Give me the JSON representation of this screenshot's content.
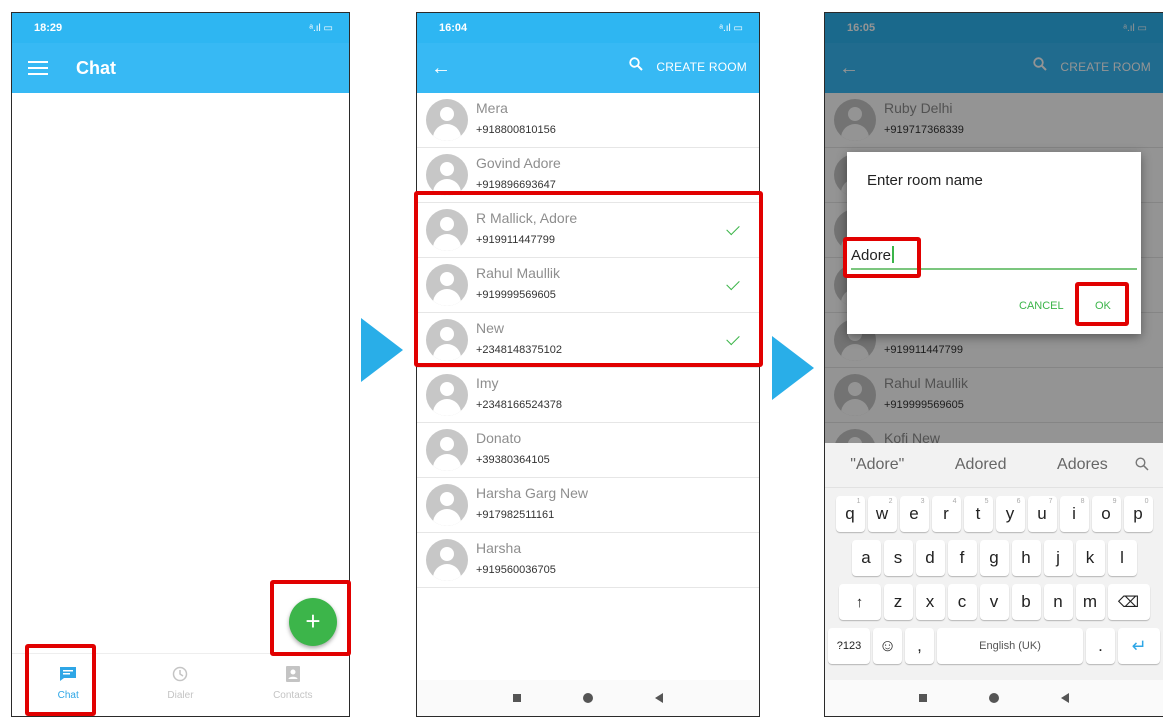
{
  "colors": {
    "accent": "#37b9f4",
    "fab": "#3cb54a",
    "highlight": "#e10000",
    "arrow": "#29aee8"
  },
  "screen1": {
    "time": "18:29",
    "signal": "ᵃ.ıl ▭",
    "title": "Chat",
    "fab_label": "+",
    "bottom_nav": [
      {
        "label": "Chat",
        "icon": "chat-icon",
        "active": true
      },
      {
        "label": "Dialer",
        "icon": "history-icon",
        "active": false
      },
      {
        "label": "Contacts",
        "icon": "contacts-icon",
        "active": false
      }
    ]
  },
  "screen2": {
    "time": "16:04",
    "signal": "ᵃ.ıl ▭",
    "create_room": "CREATE ROOM",
    "contacts": [
      {
        "name": "Mera",
        "phone": "+918800810156",
        "checked": false
      },
      {
        "name": "Govind Adore",
        "phone": "+919896693647",
        "checked": false
      },
      {
        "name": "R Mallick, Adore",
        "phone": "+919911447799",
        "checked": true
      },
      {
        "name": "Rahul Maullik",
        "phone": "+919999569605",
        "checked": true
      },
      {
        "name": "New",
        "phone": "+2348148375102",
        "checked": true
      },
      {
        "name": "Imy",
        "phone": "+2348166524378",
        "checked": false
      },
      {
        "name": "Donato",
        "phone": "+39380364105",
        "checked": false
      },
      {
        "name": "Harsha Garg New",
        "phone": "+917982511161",
        "checked": false
      },
      {
        "name": "Harsha",
        "phone": "+919560036705",
        "checked": false
      }
    ]
  },
  "screen3": {
    "time": "16:05",
    "signal": "ᵃ.ıl ▭",
    "create_room": "CREATE ROOM",
    "contacts": [
      {
        "name": "Ruby Delhi",
        "phone": "+919717368339"
      },
      {
        "name": "",
        "phone": ""
      },
      {
        "name": "",
        "phone": ""
      },
      {
        "name": "",
        "phone": ""
      },
      {
        "name": "",
        "phone": "+919911447799"
      },
      {
        "name": "Rahul Maullik",
        "phone": "+919999569605"
      },
      {
        "name": "Kofi New",
        "phone": ""
      }
    ],
    "dialog": {
      "title": "Enter room name",
      "input_value": "Adore",
      "cancel": "CANCEL",
      "ok": "OK"
    },
    "keyboard": {
      "suggestions": [
        "\"Adore\"",
        "Adored",
        "Adores"
      ],
      "row1": [
        [
          "q",
          "1"
        ],
        [
          "w",
          "2"
        ],
        [
          "e",
          "3"
        ],
        [
          "r",
          "4"
        ],
        [
          "t",
          "5"
        ],
        [
          "y",
          "6"
        ],
        [
          "u",
          "7"
        ],
        [
          "i",
          "8"
        ],
        [
          "o",
          "9"
        ],
        [
          "p",
          "0"
        ]
      ],
      "row2": [
        "a",
        "s",
        "d",
        "f",
        "g",
        "h",
        "j",
        "k",
        "l"
      ],
      "row3": [
        "z",
        "x",
        "c",
        "v",
        "b",
        "n",
        "m"
      ],
      "shift": "↑",
      "backspace": "⌫",
      "symbols": "?123",
      "emoji": "☺",
      "comma": ",",
      "space": "English (UK)",
      "period": ".",
      "enter": "↵"
    }
  }
}
